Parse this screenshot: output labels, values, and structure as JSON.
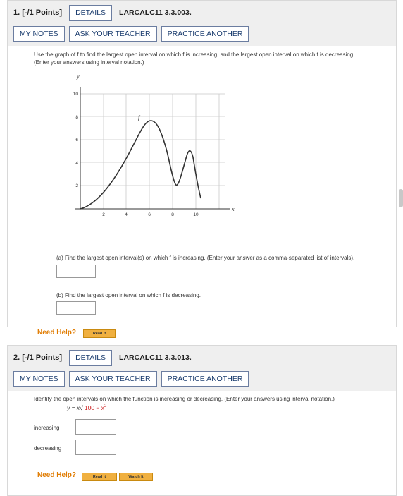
{
  "q1": {
    "number": "1. [-/1 Points]",
    "details": "DETAILS",
    "code": "LARCALC11 3.3.003.",
    "my_notes": "MY NOTES",
    "ask_teacher": "ASK YOUR TEACHER",
    "practice": "PRACTICE ANOTHER",
    "instruction_1": "Use the graph of f to find the largest open interval on which f is increasing, and the largest open interval on which f is decreasing.",
    "instruction_2": "(Enter your answers using interval notation.)",
    "graph": {
      "y_label": "y",
      "x_label": "x",
      "curve_label": "f",
      "y_ticks": [
        "10",
        "8",
        "6",
        "4",
        "2"
      ],
      "x_ticks": [
        "2",
        "4",
        "6",
        "8",
        "10"
      ]
    },
    "part_a": "(a) Find the largest open interval(s) on which f is increasing. (Enter your answer as a comma-separated list of intervals).",
    "part_b": "(b) Find the largest open interval on which f is decreasing.",
    "need_help": "Need Help?",
    "read_it": "Read It"
  },
  "q2": {
    "number": "2. [-/1 Points]",
    "details": "DETAILS",
    "code": "LARCALC11 3.3.013.",
    "my_notes": "MY NOTES",
    "ask_teacher": "ASK YOUR TEACHER",
    "practice": "PRACTICE ANOTHER",
    "instruction": "Identify the open intervals on which the function is increasing or decreasing. (Enter your answers using interval notation.)",
    "eq_prefix": "y = x",
    "eq_radicand": "100 − x",
    "eq_exp": "2",
    "increasing": "increasing",
    "decreasing": "decreasing",
    "need_help": "Need Help?",
    "read_it": "Read It",
    "watch_it": "Watch It"
  }
}
